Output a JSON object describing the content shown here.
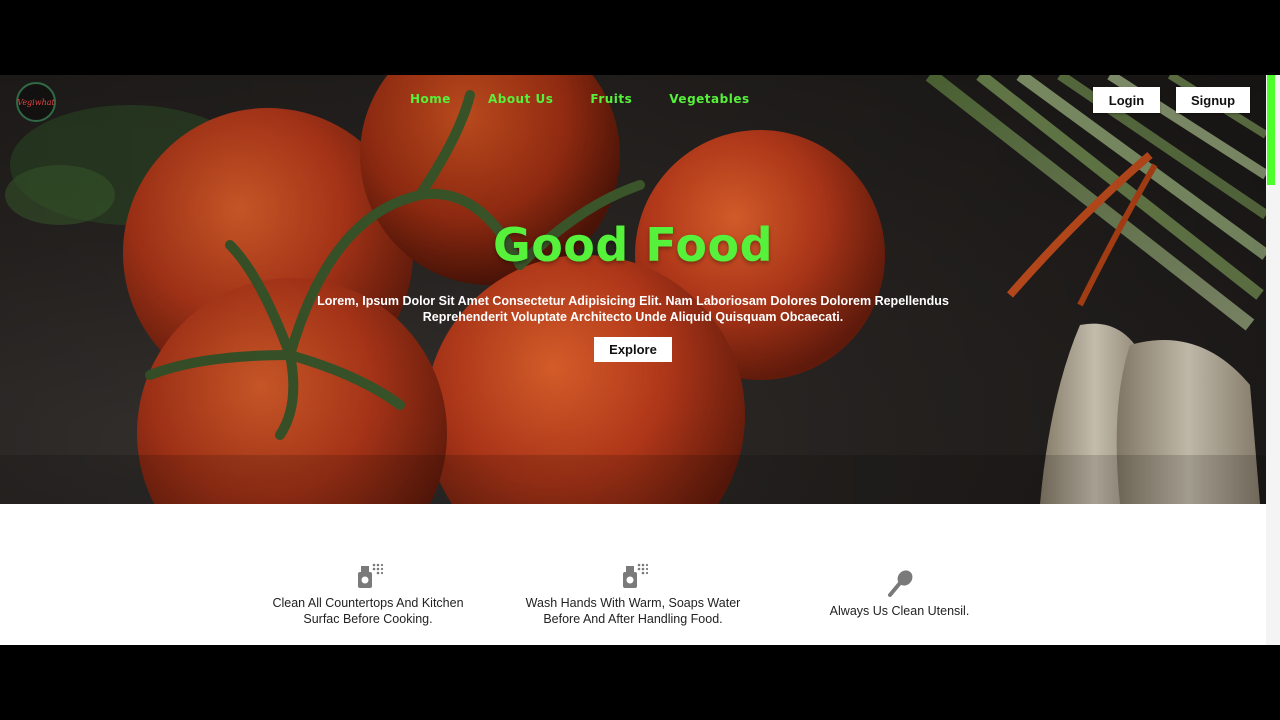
{
  "brand": {
    "logo_text": "Vegiwhat"
  },
  "nav": {
    "items": [
      {
        "label": "Home"
      },
      {
        "label": "About Us"
      },
      {
        "label": "Fruits"
      },
      {
        "label": "Vegetables"
      }
    ],
    "login_label": "Login",
    "signup_label": "Signup"
  },
  "hero": {
    "title": "Good Food",
    "subtitle": "Lorem, Ipsum Dolor Sit Amet Consectetur Adipisicing Elit. Nam Laboriosam Dolores Dolorem Repellendus Reprehenderit Voluptate Architecto Unde Aliquid Quisquam Obcaecati.",
    "button_label": "Explore"
  },
  "tips": [
    {
      "icon": "spray-bottle-icon",
      "text": "Clean All Countertops And Kitchen\nSurfac Before Cooking."
    },
    {
      "icon": "spray-bottle-icon",
      "text": "Wash Hands With Warm, Soaps Water\nBefore And After Handling Food."
    },
    {
      "icon": "spoon-icon",
      "text": "Always Us Clean Utensil."
    }
  ],
  "colors": {
    "accent_green": "#56f13a",
    "icon_gray": "#7a7a7a",
    "hero_tomato": "#b8391a",
    "scroll_thumb": "#4cff2a"
  }
}
